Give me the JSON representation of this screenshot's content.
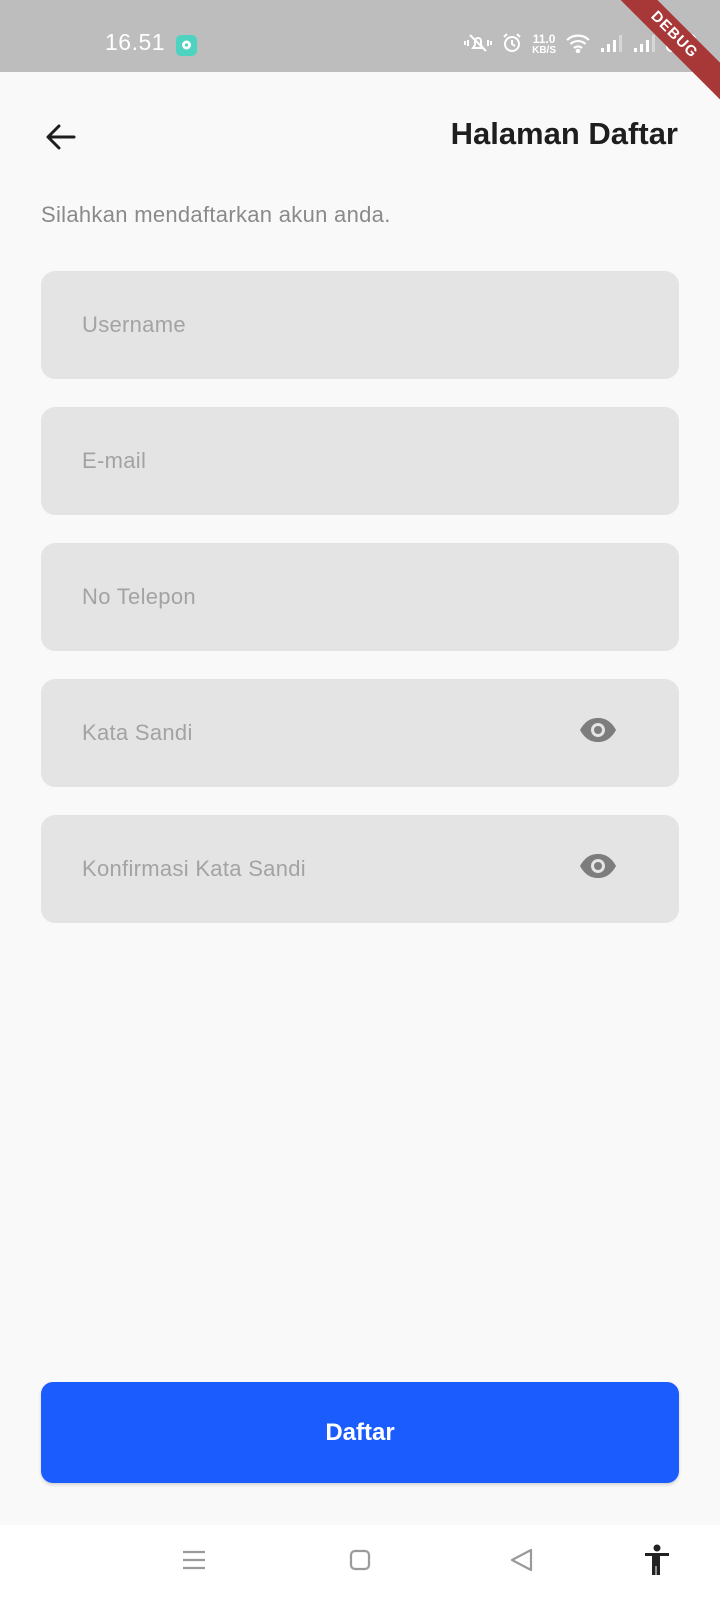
{
  "status_bar": {
    "time": "16.51",
    "net_speed_value": "11.0",
    "net_speed_unit": "KB/S",
    "debug_label": "DEBUG"
  },
  "header": {
    "title": "Halaman Daftar"
  },
  "subtitle": "Silahkan mendaftarkan akun anda.",
  "form": {
    "username_placeholder": "Username",
    "email_placeholder": "E-mail",
    "phone_placeholder": "No Telepon",
    "password_placeholder": "Kata Sandi",
    "confirm_password_placeholder": "Konfirmasi Kata Sandi"
  },
  "submit_label": "Daftar",
  "icons": {
    "back": "arrow-left-icon",
    "visibility": "eye-icon",
    "nav": [
      "menu-icon",
      "home-square-icon",
      "back-triangle-icon",
      "accessibility-icon"
    ]
  },
  "colors": {
    "primary": "#1b5cff",
    "field_bg": "#e4e4e4",
    "status_bar": "#bdbdbd",
    "debug_banner": "#a83737"
  }
}
